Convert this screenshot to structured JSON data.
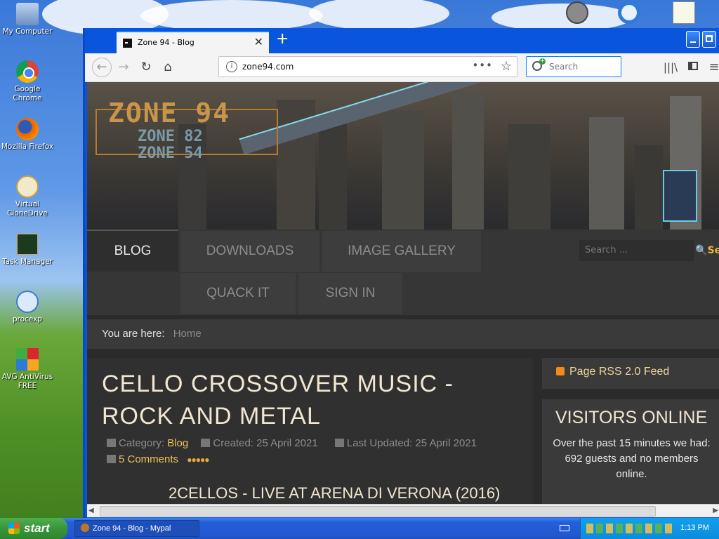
{
  "desktop": {
    "icons": [
      {
        "label": "My Computer"
      },
      {
        "label": "Google Chrome"
      },
      {
        "label": "Mozilla Firefox"
      },
      {
        "label": "Virtual CloneDrive"
      },
      {
        "label": "Task Manager"
      },
      {
        "label": "procexp"
      },
      {
        "label": "AVG AntiVirus FREE"
      }
    ]
  },
  "browser": {
    "tab_title": "Zone 94 - Blog",
    "url": "zone94.com",
    "search_placeholder": "Search"
  },
  "site": {
    "logo_main": "ZONE 94",
    "logo_sub1": "ZONE 82",
    "logo_sub2": "ZONE 54",
    "menu": [
      "BLOG",
      "DOWNLOADS",
      "IMAGE GALLERY",
      "QUACK IT",
      "SIGN IN"
    ],
    "search_placeholder": "Search ...",
    "search_button": "Se",
    "breadcrumb_label": "You are here:",
    "breadcrumb_home": "Home",
    "article": {
      "title": "CELLO CROSSOVER MUSIC - ROCK AND METAL",
      "category_label": "Category:",
      "category": "Blog",
      "created": "Created: 25 April 2021",
      "updated": "Last Updated: 25 April 2021",
      "comments": "5 Comments",
      "subtitle": "2CELLOS - LIVE AT ARENA DI VERONA (2016)"
    },
    "sidebar": {
      "rss": "Page RSS 2.0 Feed",
      "visitors_title": "VISITORS ONLINE",
      "visitors_text1": "Over the past 15 minutes we had:",
      "visitors_text2": "692 guests and no members online."
    }
  },
  "taskbar": {
    "start": "start",
    "task": "Zone 94 - Blog - Mypal",
    "clock": "1:13 PM"
  }
}
